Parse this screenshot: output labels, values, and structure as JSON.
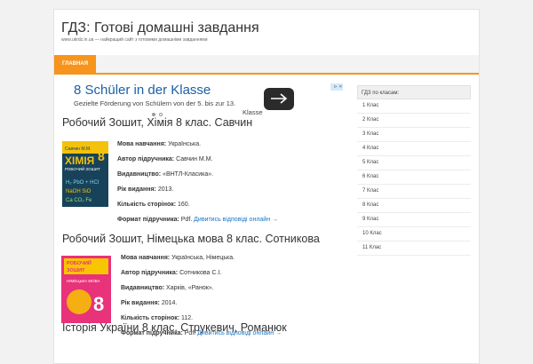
{
  "site": {
    "title": "ГДЗ: Готові домашні завдання",
    "description": "www.ukrdz.in.ua — найкращий сайт з готовими домашніми завданнями"
  },
  "nav": {
    "items": [
      {
        "label": "ГЛАВНАЯ"
      }
    ]
  },
  "ad": {
    "title": "8 Schüler in der Klasse",
    "subtitle": "Gezielte Förderung von Schülern von der 5. bis zur 13.",
    "subtitle_cut": "Klasse",
    "badge": "⊳ ✕"
  },
  "books": [
    {
      "title": "Робочий Зошит, Хімія 8 клас. Савчин",
      "cover": {
        "subject": "ХІМІЯ",
        "subtitle": "РОБОЧИЙ ЗОШИТ",
        "grade": "8",
        "bg": "#17425a",
        "accent": "#f4c20d"
      },
      "fields": [
        {
          "label": "Мова навчання:",
          "value": "Українська."
        },
        {
          "label": "Автор підручника:",
          "value": "Савчин М.М."
        },
        {
          "label": "Видавництво:",
          "value": "«ВНТЛ-Класика»."
        },
        {
          "label": "Рік видання:",
          "value": "2013."
        },
        {
          "label": "Кількість сторінок:",
          "value": "160."
        },
        {
          "label": "Формат підручника:",
          "value": "Pdf.",
          "link": "Дивитись відповіді онлайн →"
        }
      ]
    },
    {
      "title": "Робочий Зошит, Німецька мова 8 клас. Сотникова",
      "cover": {
        "subject": "РОБОЧИЙ ЗОШИТ",
        "subtitle": "НІМЕЦЬКА МОВА",
        "grade": "8",
        "bg": "#e8327a",
        "accent": "#f7c600"
      },
      "fields": [
        {
          "label": "Мова навчання:",
          "value": "Українська, Німецька."
        },
        {
          "label": "Автор підручника:",
          "value": "Сотникова С.І."
        },
        {
          "label": "Видавництво:",
          "value": "Харків, «Ранок»."
        },
        {
          "label": "Рік видання:",
          "value": "2014."
        },
        {
          "label": "Кількість сторінок:",
          "value": "112."
        },
        {
          "label": "Формат підручника:",
          "value": "Pdf.",
          "link": "Дивитись відповіді онлайн →"
        }
      ]
    },
    {
      "title": "Історія України 8 клас. Струкевич, Романюк"
    }
  ],
  "sidebar": {
    "heading": "ГДЗ по класам:",
    "items": [
      "1 Клас",
      "2 Клас",
      "3 Клас",
      "4 Клас",
      "5 Клас",
      "6 Клас",
      "7 Клас",
      "8 Клас",
      "9 Клас",
      "10 Клас",
      "11 Клас"
    ]
  }
}
